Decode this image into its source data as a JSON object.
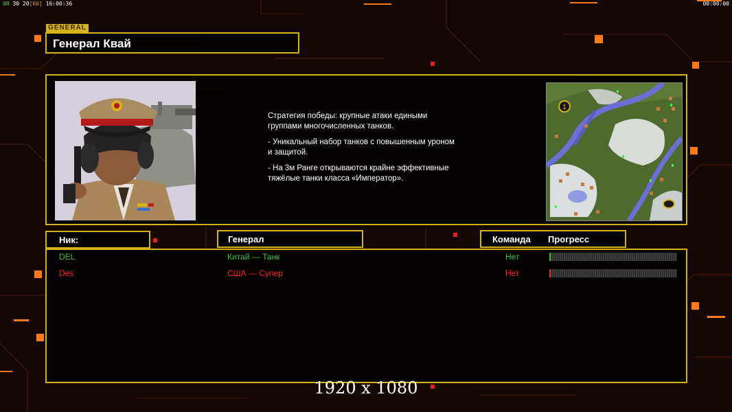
{
  "hud": {
    "left_green": "0R",
    "left_nums": "30 20",
    "left_bracket": "[60]",
    "left_time": "16:00:36",
    "right_time": "00:00:00"
  },
  "general_tag": "GENERAL",
  "general_name": "Генерал Квай",
  "description": [
    "Стратегия победы: крупные атаки едиными\n группами многочисленных танков.",
    "- Уникальный набор танков с повышенным уроном\n и защитой.",
    "- На 3м Ранге открываются крайне эффективные\n тяжёлые танки класса «Император»."
  ],
  "headers": {
    "nick": "Ник:",
    "general": "Генерал",
    "team": "Команда",
    "progress": "Прогресс"
  },
  "players": [
    {
      "nick": "DEL",
      "general": "Китай — Танк",
      "team": "Нет",
      "progress": 0.01,
      "color": "#3cc33c"
    },
    {
      "nick": "Des",
      "general": "США — Супер",
      "team": "Нет",
      "progress": 0.01,
      "color": "#ff2020"
    }
  ],
  "minimap_marker": "1",
  "resolution": "1920 x 1080",
  "colors": {
    "frame": "#d8b21a",
    "accent": "#ff6a00"
  }
}
